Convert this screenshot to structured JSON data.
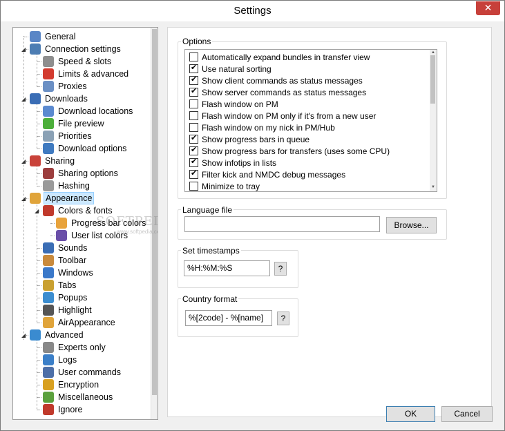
{
  "window": {
    "title": "Settings",
    "close_glyph": "✕"
  },
  "tree": {
    "items": [
      {
        "label": "General",
        "icon": "user-icon",
        "color": "#5a86c6",
        "level": 1
      },
      {
        "label": "Connection settings",
        "icon": "connection-icon",
        "color": "#4d7db3",
        "level": 1
      },
      {
        "label": "Speed & slots",
        "icon": "hourglass-icon",
        "color": "#8e8e8e",
        "level": 2
      },
      {
        "label": "Limits & advanced",
        "icon": "limit-sign-icon",
        "color": "#d33b2f",
        "level": 2
      },
      {
        "label": "Proxies",
        "icon": "proxy-icon",
        "color": "#6a8fc4",
        "level": 2
      },
      {
        "label": "Downloads",
        "icon": "downloads-icon",
        "color": "#3a6db5",
        "level": 1
      },
      {
        "label": "Download locations",
        "icon": "folder-icon",
        "color": "#5b8ad0",
        "level": 2
      },
      {
        "label": "File preview",
        "icon": "play-icon",
        "color": "#4caf3a",
        "level": 2
      },
      {
        "label": "Priorities",
        "icon": "priorities-icon",
        "color": "#8aa1b5",
        "level": 2
      },
      {
        "label": "Download options",
        "icon": "download-options-icon",
        "color": "#3f7ac0",
        "level": 2
      },
      {
        "label": "Sharing",
        "icon": "sharing-icon",
        "color": "#c9423a",
        "level": 1
      },
      {
        "label": "Sharing options",
        "icon": "sharing-options-icon",
        "color": "#9c3d3d",
        "level": 2
      },
      {
        "label": "Hashing",
        "icon": "hashing-icon",
        "color": "#9a9a9a",
        "level": 2
      },
      {
        "label": "Appearance",
        "icon": "palette-icon",
        "color": "#e0a43a",
        "level": 1
      },
      {
        "label": "Colors & fonts",
        "icon": "colors-icon",
        "color": "#c0392b",
        "level": 2
      },
      {
        "label": "Progress bar colors",
        "icon": "progress-colors-icon",
        "color": "#e8a33c",
        "level": 3
      },
      {
        "label": "User list colors",
        "icon": "userlist-colors-icon",
        "color": "#6a4fa8",
        "level": 3
      },
      {
        "label": "Sounds",
        "icon": "speaker-icon",
        "color": "#3a6db5",
        "level": 2
      },
      {
        "label": "Toolbar",
        "icon": "toolbar-icon",
        "color": "#c98a3c",
        "level": 2
      },
      {
        "label": "Windows",
        "icon": "window-icon",
        "color": "#3a78c9",
        "level": 2
      },
      {
        "label": "Tabs",
        "icon": "tabs-icon",
        "color": "#c9a030",
        "level": 2
      },
      {
        "label": "Popups",
        "icon": "popup-icon",
        "color": "#3b8dd0",
        "level": 2
      },
      {
        "label": "Highlight",
        "icon": "highlight-icon",
        "color": "#555555",
        "level": 2
      },
      {
        "label": "AirAppearance",
        "icon": "air-appearance-icon",
        "color": "#e0a43a",
        "level": 2
      },
      {
        "label": "Advanced",
        "icon": "advanced-gear-icon",
        "color": "#3a8bd0",
        "level": 1
      },
      {
        "label": "Experts only",
        "icon": "experts-gears-icon",
        "color": "#888888",
        "level": 2
      },
      {
        "label": "Logs",
        "icon": "logs-icon",
        "color": "#3b7fc8",
        "level": 2
      },
      {
        "label": "User commands",
        "icon": "user-commands-icon",
        "color": "#4d6fa8",
        "level": 2
      },
      {
        "label": "Encryption",
        "icon": "lock-icon",
        "color": "#d8a020",
        "level": 2
      },
      {
        "label": "Miscellaneous",
        "icon": "pencil-icon",
        "color": "#5aa03c",
        "level": 2
      },
      {
        "label": "Ignore",
        "icon": "ignore-icon",
        "color": "#c0392b",
        "level": 2
      }
    ],
    "selected_index": 13,
    "watermark": "SOFTPEDIA",
    "watermark_sub": "www.softpedia.com"
  },
  "options": {
    "title": "Options",
    "items": [
      {
        "label": "Automatically expand bundles in transfer view",
        "checked": false
      },
      {
        "label": "Use natural sorting",
        "checked": true
      },
      {
        "label": "Show client commands as status messages",
        "checked": true
      },
      {
        "label": "Show server commands as status messages",
        "checked": true
      },
      {
        "label": "Flash window on PM",
        "checked": false
      },
      {
        "label": "Flash window on PM only if it's from a new user",
        "checked": false
      },
      {
        "label": "Flash window on my nick in PM/Hub",
        "checked": false
      },
      {
        "label": "Show progress bars in queue",
        "checked": true
      },
      {
        "label": "Show progress bars for transfers (uses some CPU)",
        "checked": true
      },
      {
        "label": "Show infotips in lists",
        "checked": true
      },
      {
        "label": "Filter kick and NMDC debug messages",
        "checked": true
      },
      {
        "label": "Minimize to tray",
        "checked": false
      }
    ]
  },
  "language": {
    "title": "Language file",
    "value": "",
    "browse_label": "Browse..."
  },
  "timestamps": {
    "title": "Set timestamps",
    "value": "%H:%M:%S",
    "help_label": "?"
  },
  "country": {
    "title": "Country format",
    "value": "%[2code] - %[name]",
    "help_label": "?"
  },
  "buttons": {
    "ok": "OK",
    "cancel": "Cancel"
  }
}
